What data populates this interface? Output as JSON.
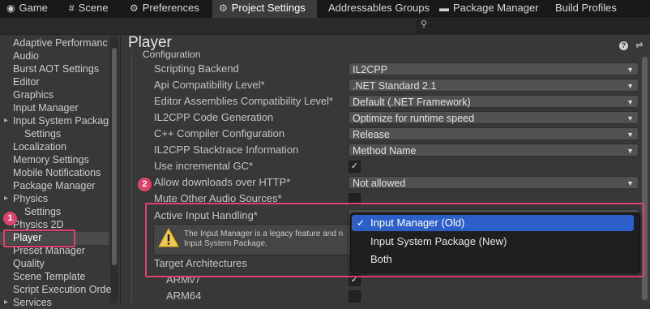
{
  "tabs": [
    {
      "label": "Game",
      "icon": "gamepad-icon"
    },
    {
      "label": "Scene",
      "icon": "grid-icon"
    },
    {
      "label": "Preferences",
      "icon": "gear-icon"
    },
    {
      "label": "Project Settings",
      "icon": "gear-icon"
    },
    {
      "label": "Addressables Groups"
    },
    {
      "label": "Package Manager",
      "icon": "package-icon"
    },
    {
      "label": "Build Profiles"
    }
  ],
  "sidebar": {
    "items": [
      "Adaptive Performanc",
      "Audio",
      "Burst AOT Settings",
      "Editor",
      "Graphics",
      "Input Manager",
      "Input System Packag",
      "Settings",
      "Localization",
      "Memory Settings",
      "Mobile Notifications",
      "Package Manager",
      "Physics",
      "Settings",
      "Physics 2D",
      "Player",
      "Preset Manager",
      "Quality",
      "Scene Template",
      "Script Execution Orde",
      "Services"
    ]
  },
  "page": {
    "title": "Player"
  },
  "section": {
    "label": "Configuration"
  },
  "rows": [
    {
      "label": "Scripting Backend",
      "value": "IL2CPP"
    },
    {
      "label": "Api Compatibility Level*",
      "value": ".NET Standard 2.1"
    },
    {
      "label": "Editor Assemblies Compatibility Level*",
      "value": "Default (.NET Framework)"
    },
    {
      "label": "IL2CPP Code Generation",
      "value": "Optimize for runtime speed"
    },
    {
      "label": "C++ Compiler Configuration",
      "value": "Release"
    },
    {
      "label": "IL2CPP Stacktrace Information",
      "value": "Method Name"
    },
    {
      "label": "Use incremental GC*",
      "checked": true
    },
    {
      "label": "Allow downloads over HTTP*",
      "value": "Not allowed"
    },
    {
      "label": "Mute Other Audio Sources*",
      "checked": false
    },
    {
      "label": "Active Input Handling*"
    }
  ],
  "help": {
    "text_line1": "The Input Manager is a legacy feature and n",
    "text_line2": "Input System Package."
  },
  "target_arch": {
    "label": "Target Architectures",
    "items": [
      {
        "label": "ARMv7",
        "checked": true
      },
      {
        "label": "ARM64",
        "checked": false
      }
    ]
  },
  "popup": {
    "options": [
      "Input Manager (Old)",
      "Input System Package (New)",
      "Both"
    ],
    "selected_index": 0,
    "check_glyph": "✓"
  },
  "badges": [
    "1",
    "2"
  ],
  "colors": {
    "highlight": "#e0426d",
    "selection": "#2c5fc7",
    "warning": "#f2c94c"
  }
}
